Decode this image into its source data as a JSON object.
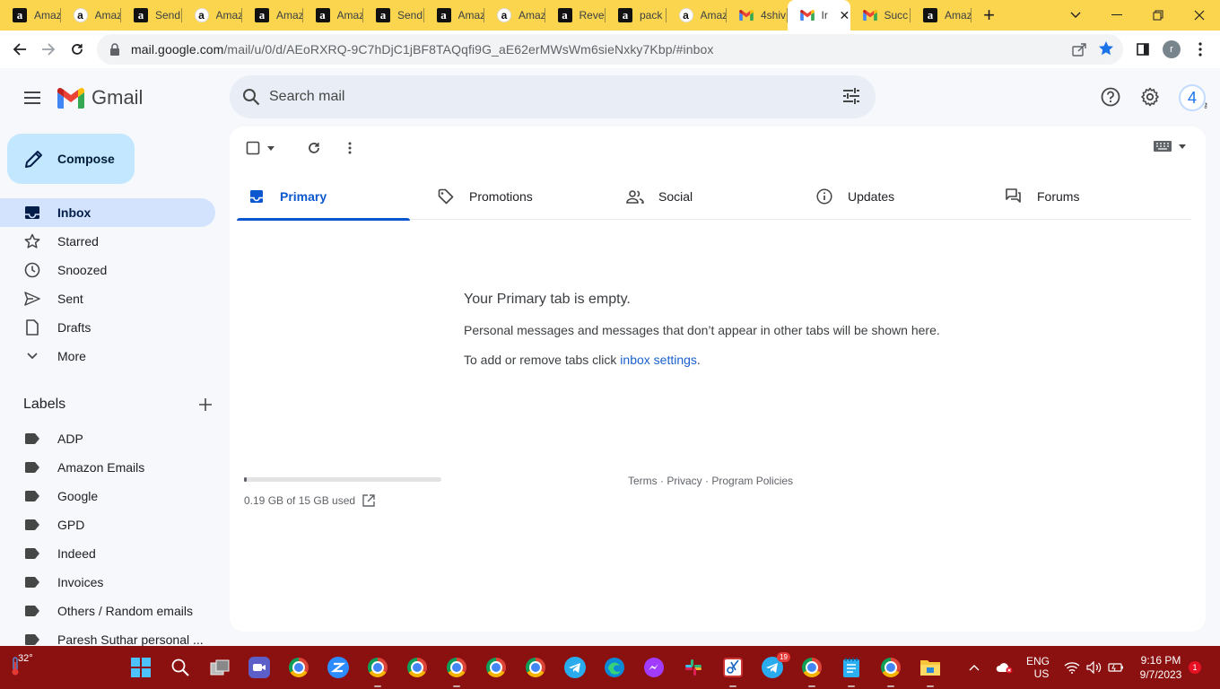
{
  "browser": {
    "tabs": [
      {
        "title": "Amaz",
        "icon": "amazon-icon"
      },
      {
        "title": "Amaz",
        "icon": "amazon-white-icon"
      },
      {
        "title": "Send",
        "icon": "amazon-icon"
      },
      {
        "title": "Amaz",
        "icon": "amazon-white-icon"
      },
      {
        "title": "Amaz",
        "icon": "amazon-icon"
      },
      {
        "title": "Amaz",
        "icon": "amazon-icon"
      },
      {
        "title": "Send",
        "icon": "amazon-icon"
      },
      {
        "title": "Amaz",
        "icon": "amazon-icon"
      },
      {
        "title": "Amaz",
        "icon": "amazon-white-icon"
      },
      {
        "title": "Rever",
        "icon": "amazon-icon"
      },
      {
        "title": "pack",
        "icon": "amazon-icon"
      },
      {
        "title": "Amaz",
        "icon": "amazon-white-icon"
      },
      {
        "title": "4shiv",
        "icon": "gmail-icon"
      },
      {
        "title": "Ir",
        "icon": "gmail-icon",
        "active": true
      },
      {
        "title": "Succ",
        "icon": "gmail-icon"
      },
      {
        "title": "Amaz",
        "icon": "amazon-icon"
      }
    ],
    "address": {
      "host": "mail.google.com",
      "path": "/mail/u/0/d/AEoRXRQ-9C7hDjC1jBF8TAQqfi9G_aE62erMWsWm6sieNxky7Kbp/#inbox"
    },
    "profile_initial": "r",
    "accent": "#fbd54e"
  },
  "gmail": {
    "logo_text": "Gmail",
    "search_placeholder": "Search mail",
    "account_initial": "4",
    "compose_label": "Compose",
    "nav": [
      {
        "label": "Inbox",
        "icon": "inbox-icon",
        "active": true
      },
      {
        "label": "Starred",
        "icon": "star-icon"
      },
      {
        "label": "Snoozed",
        "icon": "clock-icon"
      },
      {
        "label": "Sent",
        "icon": "send-icon"
      },
      {
        "label": "Drafts",
        "icon": "draft-icon"
      },
      {
        "label": "More",
        "icon": "chevron-down-icon"
      }
    ],
    "labels_title": "Labels",
    "labels": [
      "ADP",
      "Amazon Emails",
      "Google",
      "GPD",
      "Indeed",
      "Invoices",
      "Others / Random emails",
      "Paresh Suthar personal ..."
    ],
    "inbox_tabs": [
      {
        "label": "Primary",
        "icon": "inbox-icon",
        "active": true
      },
      {
        "label": "Promotions",
        "icon": "tag-icon"
      },
      {
        "label": "Social",
        "icon": "people-icon"
      },
      {
        "label": "Updates",
        "icon": "info-icon"
      },
      {
        "label": "Forums",
        "icon": "forum-icon"
      }
    ],
    "empty_title": "Your Primary tab is empty.",
    "empty_desc": "Personal messages and messages that don’t appear in other tabs will be shown here.",
    "empty_settings_prefix": "To add or remove tabs click ",
    "empty_settings_link": "inbox settings",
    "empty_settings_suffix": ".",
    "storage": {
      "used_text": "0.19 GB of 15 GB used",
      "fraction": 0.0127
    },
    "footer": {
      "terms": "Terms",
      "privacy": "Privacy",
      "policies": "Program Policies",
      "sep": " · "
    }
  },
  "taskbar": {
    "weather": "32°",
    "language": "ENG",
    "region": "US",
    "time": "9:16 PM",
    "date": "9/7/2023",
    "notifications": "1",
    "telegram_badge": "19"
  }
}
